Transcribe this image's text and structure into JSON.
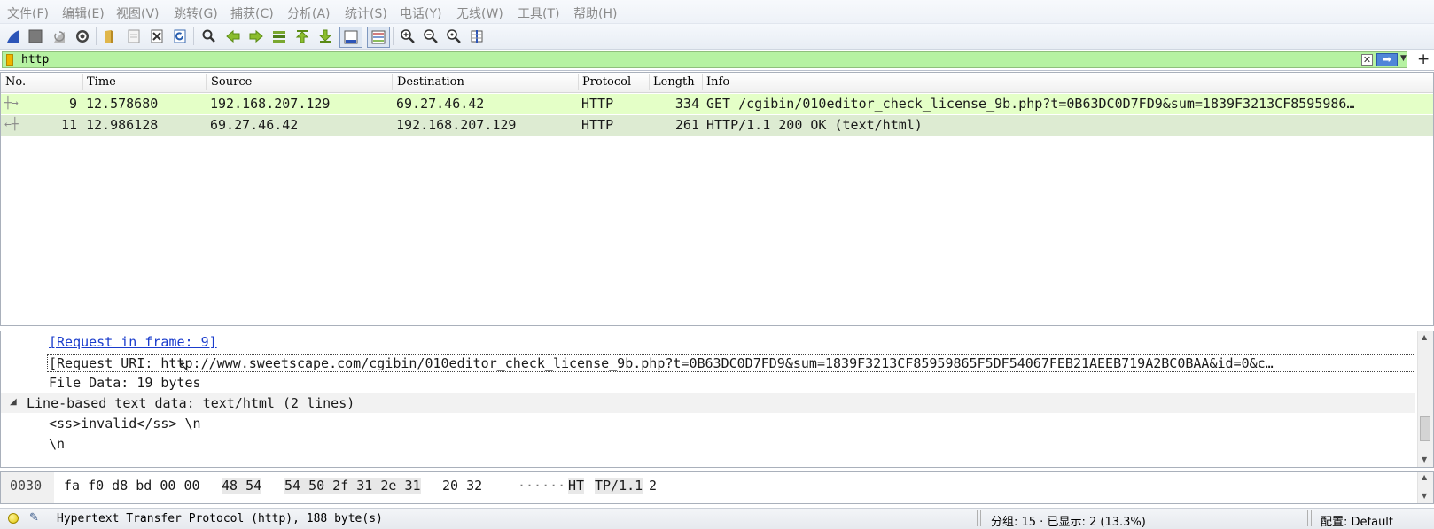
{
  "menu": [
    "文件(F)",
    "编辑(E)",
    "视图(V)",
    "跳转(G)",
    "捕获(C)",
    "分析(A)",
    "统计(S)",
    "电话(Y)",
    "无线(W)",
    "工具(T)",
    "帮助(H)"
  ],
  "toolbar": {
    "icons": [
      "shark-fin-start-icon",
      "stop-capture-icon",
      "restart-capture-icon",
      "capture-options-icon",
      "open-file-icon",
      "save-file-icon",
      "close-file-icon",
      "reload-file-icon",
      "find-packet-icon",
      "go-back-icon",
      "go-forward-icon",
      "go-to-packet-icon",
      "first-packet-icon",
      "last-packet-icon",
      "auto-scroll-icon",
      "colorize-icon",
      "zoom-in-icon",
      "zoom-out-icon",
      "normal-size-icon",
      "resize-columns-icon"
    ]
  },
  "filter": {
    "value": "http",
    "add_label": "+"
  },
  "packet_list": {
    "columns": [
      "No.",
      "Time",
      "Source",
      "Destination",
      "Protocol",
      "Length",
      "Info"
    ],
    "rows": [
      {
        "no": "9",
        "time": "12.578680",
        "source": "192.168.207.129",
        "destination": "69.27.46.42",
        "protocol": "HTTP",
        "length": "334",
        "info": "GET /cgibin/010editor_check_license_9b.php?t=0B63DC0D7FD9&sum=1839F3213CF8595986…"
      },
      {
        "no": "11",
        "time": "12.986128",
        "source": "69.27.46.42",
        "destination": "192.168.207.129",
        "protocol": "HTTP",
        "length": "261",
        "info": "HTTP/1.1 200 OK  (text/html)"
      }
    ]
  },
  "details": {
    "request_in_frame": "[Request in frame: 9]",
    "request_uri": "[Request URI: http://www.sweetscape.com/cgibin/010editor_check_license_9b.php?t=0B63DC0D7FD9&sum=1839F3213CF85959865F5DF54067FEB21AEEB719A2BC0BAA&id=0&c…",
    "file_data": "File Data: 19 bytes",
    "line_based": "Line-based text data: text/html (2 lines)",
    "line1": "<ss>invalid</ss> \\n",
    "line2": "\\n"
  },
  "bytes": {
    "offset": "0030",
    "hex_a": "fa f0 d8 bd 00 00",
    "hex_b": "48 54",
    "hex_c": "54 50 2f 31 2e 31",
    "hex_d": "20 32",
    "ascii_dots": "······",
    "ascii_ht": "HT",
    "ascii_tp": "TP/1.1",
    "ascii_end": " 2"
  },
  "status": {
    "protocol_info": "Hypertext Transfer Protocol (http), 188 byte(s)",
    "packets": "分组: 15 · 已显示: 2 (13.3%)",
    "profile": "配置: Default"
  },
  "colors": {
    "filter_bg": "#b6f2a2",
    "row_request": "#e4ffc7",
    "row_response": "#ddebd2",
    "link": "#1a3ccc"
  }
}
